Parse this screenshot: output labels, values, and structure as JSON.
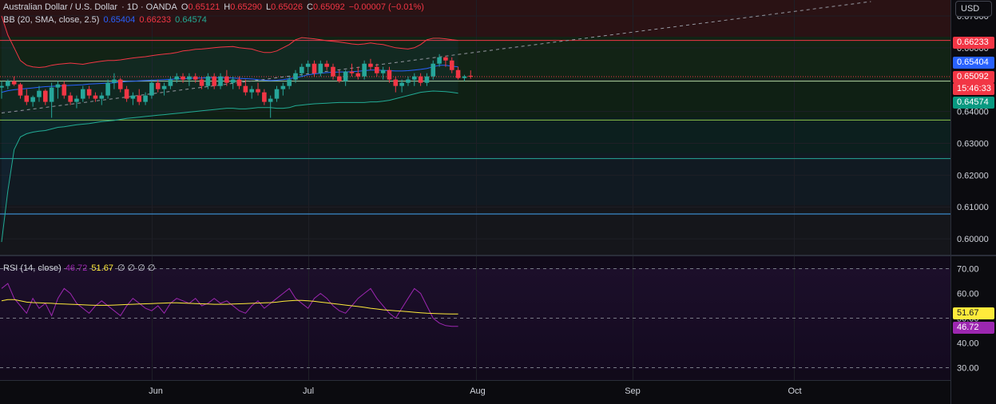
{
  "header": {
    "symbol": "Australian Dollar / U.S. Dollar",
    "meta": "· 1D · OANDA",
    "open_label": "O",
    "open": "0.65121",
    "high_label": "H",
    "high": "0.65290",
    "low_label": "L",
    "low": "0.65026",
    "close_label": "C",
    "close": "0.65092",
    "change": "−0.00007 (−0.01%)"
  },
  "bb_legend": {
    "name": "BB (20, SMA, close, 2.5)",
    "basis": "0.65404",
    "upper": "0.66233",
    "lower": "0.64574"
  },
  "rsi_legend": {
    "name": "RSI (14, close)",
    "rsi": "46.72",
    "ma": "51.67",
    "extras": "∅ ∅ ∅ ∅"
  },
  "currency_button": "USD",
  "price_axis": {
    "ticks": [
      "0.67000",
      "0.66000",
      "0.65000",
      "0.64000",
      "0.63000",
      "0.62000",
      "0.61000",
      "0.60000"
    ],
    "tick_values": [
      0.67,
      0.66,
      0.65,
      0.64,
      0.63,
      0.62,
      0.61,
      0.6
    ],
    "tags": {
      "upper": "0.66233",
      "basis": "0.65404",
      "close": "0.65092",
      "countdown": "15:46:33",
      "lower": "0.64574"
    }
  },
  "rsi_axis": {
    "ticks": [
      "70.00",
      "60.00",
      "50.00",
      "40.00",
      "30.00"
    ],
    "tick_values": [
      70,
      60,
      50,
      40,
      30
    ],
    "tags": {
      "ma": "51.67",
      "rsi": "46.72"
    }
  },
  "time_axis": {
    "labels": [
      "Jun",
      "Jul",
      "Aug",
      "Sep",
      "Oct"
    ]
  },
  "colors": {
    "up": "#26a69a",
    "down": "#f23645",
    "basis": "#2962ff",
    "upper": "#f23645",
    "lower": "#22ab94",
    "rsi": "#9c27b0",
    "rsi_ma": "#ffeb3b"
  },
  "chart_data": {
    "type": "candlestick",
    "price_range": [
      0.595,
      0.675
    ],
    "horizontal_levels": [
      0.6623,
      0.6495,
      0.6373,
      0.6252,
      0.6078
    ],
    "candles": [
      [
        0.6475,
        0.6495,
        0.644,
        0.648
      ],
      [
        0.648,
        0.65,
        0.647,
        0.6495
      ],
      [
        0.6495,
        0.651,
        0.648,
        0.6485
      ],
      [
        0.6485,
        0.649,
        0.644,
        0.645
      ],
      [
        0.645,
        0.647,
        0.642,
        0.643
      ],
      [
        0.643,
        0.645,
        0.6415,
        0.6445
      ],
      [
        0.6445,
        0.648,
        0.643,
        0.6465
      ],
      [
        0.6465,
        0.647,
        0.642,
        0.643
      ],
      [
        0.643,
        0.649,
        0.638,
        0.6475
      ],
      [
        0.6475,
        0.6495,
        0.644,
        0.6485
      ],
      [
        0.6485,
        0.6495,
        0.644,
        0.645
      ],
      [
        0.645,
        0.646,
        0.642,
        0.643
      ],
      [
        0.643,
        0.645,
        0.641,
        0.644
      ],
      [
        0.644,
        0.648,
        0.643,
        0.647
      ],
      [
        0.647,
        0.648,
        0.644,
        0.645
      ],
      [
        0.645,
        0.646,
        0.643,
        0.644
      ],
      [
        0.644,
        0.646,
        0.642,
        0.645
      ],
      [
        0.645,
        0.65,
        0.644,
        0.649
      ],
      [
        0.649,
        0.652,
        0.647,
        0.65
      ],
      [
        0.65,
        0.6505,
        0.646,
        0.647
      ],
      [
        0.647,
        0.648,
        0.643,
        0.644
      ],
      [
        0.644,
        0.646,
        0.642,
        0.645
      ],
      [
        0.645,
        0.647,
        0.642,
        0.643
      ],
      [
        0.643,
        0.646,
        0.642,
        0.645
      ],
      [
        0.645,
        0.65,
        0.644,
        0.649
      ],
      [
        0.649,
        0.65,
        0.646,
        0.647
      ],
      [
        0.647,
        0.649,
        0.645,
        0.648
      ],
      [
        0.648,
        0.651,
        0.647,
        0.65
      ],
      [
        0.65,
        0.652,
        0.649,
        0.651
      ],
      [
        0.651,
        0.652,
        0.649,
        0.65
      ],
      [
        0.65,
        0.652,
        0.648,
        0.651
      ],
      [
        0.651,
        0.652,
        0.649,
        0.65
      ],
      [
        0.65,
        0.651,
        0.647,
        0.648
      ],
      [
        0.648,
        0.652,
        0.647,
        0.651
      ],
      [
        0.651,
        0.652,
        0.647,
        0.648
      ],
      [
        0.648,
        0.652,
        0.647,
        0.651
      ],
      [
        0.651,
        0.653,
        0.648,
        0.649
      ],
      [
        0.649,
        0.651,
        0.647,
        0.65
      ],
      [
        0.65,
        0.651,
        0.647,
        0.648
      ],
      [
        0.648,
        0.65,
        0.645,
        0.646
      ],
      [
        0.646,
        0.648,
        0.644,
        0.647
      ],
      [
        0.647,
        0.649,
        0.645,
        0.646
      ],
      [
        0.646,
        0.647,
        0.642,
        0.643
      ],
      [
        0.643,
        0.645,
        0.638,
        0.644
      ],
      [
        0.644,
        0.648,
        0.643,
        0.647
      ],
      [
        0.647,
        0.649,
        0.645,
        0.648
      ],
      [
        0.648,
        0.651,
        0.647,
        0.65
      ],
      [
        0.65,
        0.653,
        0.649,
        0.652
      ],
      [
        0.652,
        0.655,
        0.651,
        0.654
      ],
      [
        0.654,
        0.656,
        0.652,
        0.655
      ],
      [
        0.655,
        0.656,
        0.651,
        0.652
      ],
      [
        0.652,
        0.656,
        0.651,
        0.655
      ],
      [
        0.655,
        0.656,
        0.653,
        0.654
      ],
      [
        0.654,
        0.655,
        0.65,
        0.651
      ],
      [
        0.651,
        0.653,
        0.649,
        0.6495
      ],
      [
        0.6495,
        0.653,
        0.648,
        0.6525
      ],
      [
        0.6525,
        0.655,
        0.651,
        0.652
      ],
      [
        0.652,
        0.654,
        0.65,
        0.651
      ],
      [
        0.651,
        0.656,
        0.65,
        0.655
      ],
      [
        0.655,
        0.6565,
        0.653,
        0.654
      ],
      [
        0.654,
        0.655,
        0.651,
        0.652
      ],
      [
        0.652,
        0.654,
        0.65,
        0.653
      ],
      [
        0.653,
        0.654,
        0.649,
        0.65
      ],
      [
        0.65,
        0.651,
        0.646,
        0.648
      ],
      [
        0.648,
        0.65,
        0.646,
        0.649
      ],
      [
        0.649,
        0.651,
        0.648,
        0.65
      ],
      [
        0.65,
        0.652,
        0.648,
        0.651
      ],
      [
        0.651,
        0.652,
        0.648,
        0.649
      ],
      [
        0.649,
        0.652,
        0.648,
        0.651
      ],
      [
        0.651,
        0.656,
        0.65,
        0.655
      ],
      [
        0.655,
        0.658,
        0.654,
        0.657
      ],
      [
        0.657,
        0.6575,
        0.654,
        0.656
      ],
      [
        0.656,
        0.657,
        0.652,
        0.653
      ],
      [
        0.653,
        0.654,
        0.65,
        0.6505
      ],
      [
        0.6505,
        0.6515,
        0.6495,
        0.651
      ],
      [
        0.65121,
        0.6529,
        0.65026,
        0.65092
      ]
    ],
    "bb_upper": [
      0.67,
      0.664,
      0.66,
      0.656,
      0.6545,
      0.654,
      0.6538,
      0.654,
      0.6545,
      0.6548,
      0.655,
      0.6552,
      0.655,
      0.6548,
      0.6552,
      0.6555,
      0.6558,
      0.656,
      0.656,
      0.6562,
      0.6565,
      0.6568,
      0.657,
      0.6572,
      0.6575,
      0.6578,
      0.658,
      0.6582,
      0.6585,
      0.659,
      0.6592,
      0.6595,
      0.6596,
      0.6598,
      0.66,
      0.6602,
      0.6603,
      0.6604,
      0.66,
      0.6598,
      0.6596,
      0.659,
      0.6585,
      0.6585,
      0.659,
      0.66,
      0.661,
      0.6625,
      0.6632,
      0.663,
      0.6628,
      0.6625,
      0.6622,
      0.662,
      0.6618,
      0.6615,
      0.6612,
      0.661,
      0.6612,
      0.6615,
      0.6612,
      0.661,
      0.6605,
      0.66,
      0.6598,
      0.6596,
      0.66,
      0.661,
      0.6625,
      0.663,
      0.663,
      0.6628,
      0.6625,
      0.6623
    ],
    "bb_basis": [
      0.646,
      0.6465,
      0.6468,
      0.647,
      0.6472,
      0.6474,
      0.6476,
      0.6478,
      0.6479,
      0.648,
      0.6481,
      0.6482,
      0.6483,
      0.6484,
      0.6486,
      0.6487,
      0.6488,
      0.6489,
      0.649,
      0.6492,
      0.6494,
      0.6495,
      0.6496,
      0.6497,
      0.6498,
      0.6499,
      0.65,
      0.6501,
      0.6502,
      0.6503,
      0.6504,
      0.6505,
      0.6505,
      0.6506,
      0.6506,
      0.6506,
      0.6506,
      0.6505,
      0.6504,
      0.6503,
      0.6502,
      0.65,
      0.6498,
      0.6497,
      0.6498,
      0.65,
      0.6503,
      0.6506,
      0.651,
      0.6515,
      0.6518,
      0.652,
      0.6522,
      0.6523,
      0.6524,
      0.6524,
      0.6525,
      0.6526,
      0.6528,
      0.653,
      0.653,
      0.6529,
      0.6528,
      0.6527,
      0.6527,
      0.6528,
      0.653,
      0.6532,
      0.6535,
      0.654,
      0.6545,
      0.6545,
      0.6542,
      0.654
    ],
    "bb_lower": [
      0.599,
      0.615,
      0.628,
      0.632,
      0.633,
      0.6335,
      0.6338,
      0.634,
      0.6345,
      0.635,
      0.6352,
      0.6355,
      0.6358,
      0.636,
      0.6362,
      0.6365,
      0.6368,
      0.637,
      0.6372,
      0.6375,
      0.6378,
      0.638,
      0.6382,
      0.6384,
      0.6386,
      0.6388,
      0.639,
      0.6392,
      0.6394,
      0.6396,
      0.6398,
      0.64,
      0.6402,
      0.6404,
      0.6406,
      0.6408,
      0.641,
      0.641,
      0.6408,
      0.6408,
      0.641,
      0.6412,
      0.6412,
      0.6412,
      0.641,
      0.641,
      0.6412,
      0.6418,
      0.642,
      0.6422,
      0.6424,
      0.6425,
      0.6426,
      0.6427,
      0.6428,
      0.6428,
      0.6428,
      0.6428,
      0.6428,
      0.643,
      0.643,
      0.6432,
      0.6435,
      0.644,
      0.6445,
      0.645,
      0.6455,
      0.646,
      0.6462,
      0.6464,
      0.6463,
      0.6462,
      0.646,
      0.6457
    ],
    "trend_line": {
      "x0_index": 0,
      "y0": 0.6395,
      "x1_index": 139,
      "y1": 0.6745
    },
    "rsi_range": [
      25,
      75
    ],
    "rsi": [
      62,
      64,
      58,
      55,
      52,
      58,
      54,
      56,
      51,
      58,
      62,
      60,
      56,
      54,
      52,
      55,
      57,
      55,
      53,
      51,
      55,
      58,
      56,
      54,
      53,
      55,
      52,
      56,
      58,
      57,
      56,
      58,
      55,
      56,
      58,
      56,
      57,
      55,
      53,
      52,
      55,
      57,
      54,
      56,
      58,
      60,
      62,
      58,
      56,
      54,
      58,
      60,
      58,
      55,
      53,
      52,
      55,
      58,
      60,
      62,
      58,
      55,
      52,
      50,
      54,
      58,
      62,
      60,
      55,
      50,
      48,
      47,
      46.7,
      46.72
    ],
    "rsi_ma": [
      57,
      57.5,
      57.5,
      57,
      56.5,
      56.3,
      56.2,
      56.1,
      56,
      55.8,
      55.7,
      55.6,
      55.5,
      55.4,
      55.3,
      55.2,
      55.2,
      55.2,
      55.3,
      55.4,
      55.5,
      55.6,
      55.7,
      55.8,
      55.9,
      56,
      56.1,
      56.2,
      56.2,
      56.1,
      56,
      55.9,
      55.8,
      55.7,
      55.6,
      55.6,
      55.6,
      55.7,
      55.8,
      55.9,
      56,
      56.1,
      56.2,
      56.3,
      56.5,
      56.8,
      57,
      57.2,
      57.2,
      57,
      56.8,
      56.5,
      56.2,
      55.9,
      55.6,
      55.3,
      55,
      54.7,
      54.4,
      54,
      53.7,
      53.4,
      53.2,
      53,
      52.8,
      52.6,
      52.4,
      52.2,
      52,
      51.9,
      51.8,
      51.75,
      51.7,
      51.67
    ],
    "rsi_levels": [
      70,
      50,
      30
    ]
  }
}
